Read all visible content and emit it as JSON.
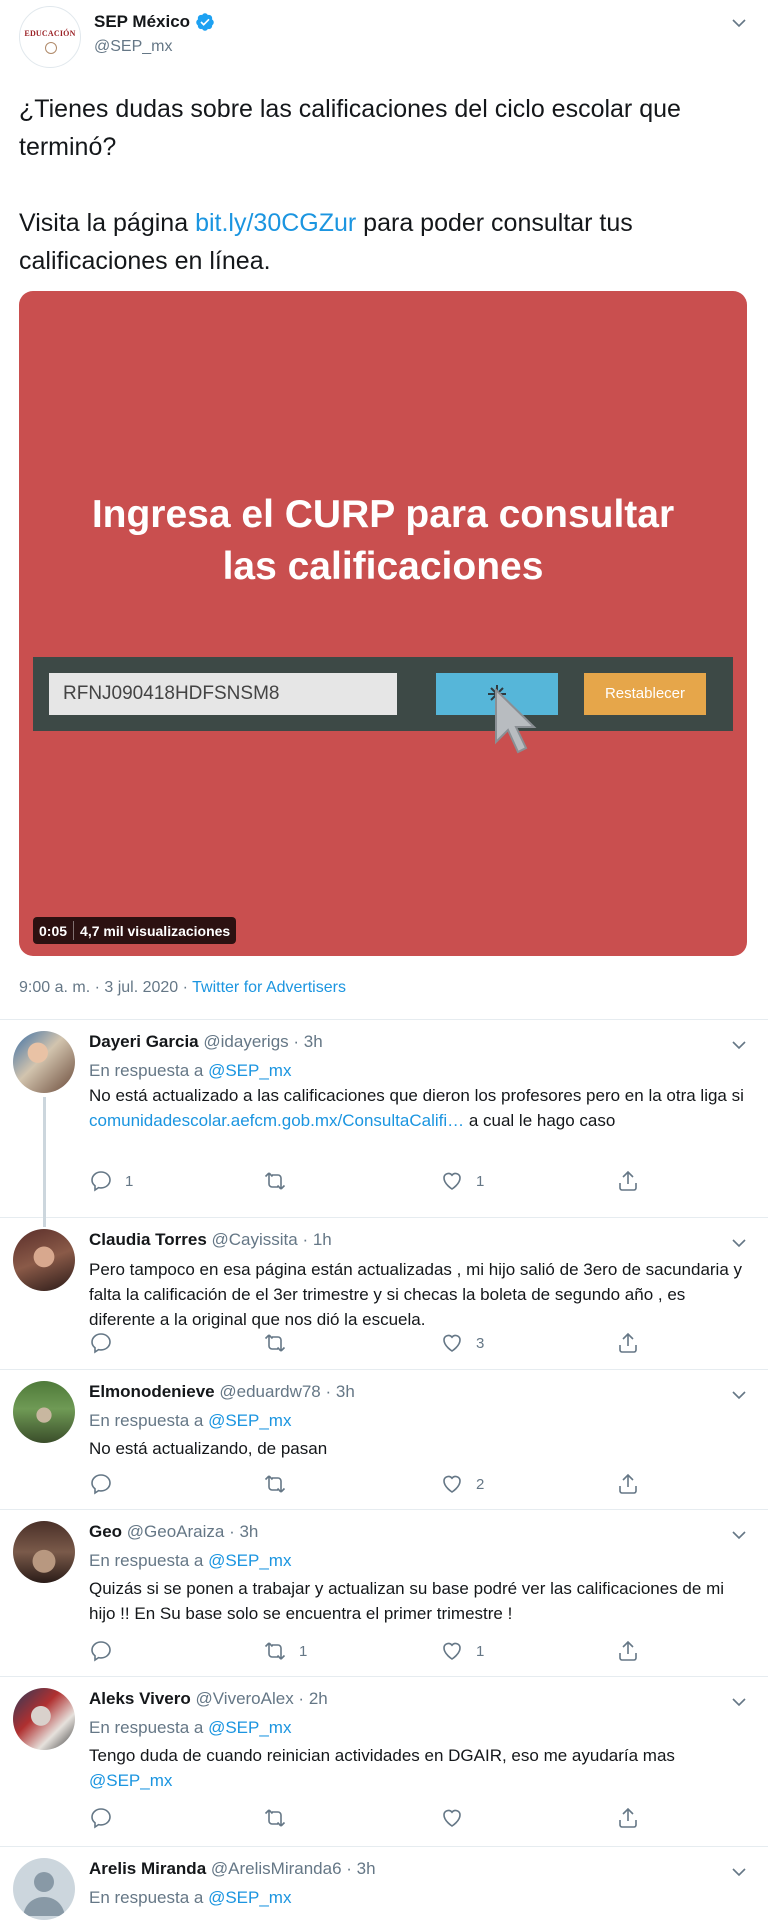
{
  "main_tweet": {
    "avatar_logo_text": "EDUCACIÓN",
    "name": "SEP México",
    "handle": "@SEP_mx",
    "text_line1": "¿Tienes dudas sobre las calificaciones del ciclo escolar que terminó?",
    "text_pre_link": "Visita la página ",
    "link": "bit.ly/30CGZur",
    "text_post_link": " para poder consultar tus calificaciones en línea.",
    "media": {
      "title_line1": "Ingresa el CURP para consultar",
      "title_line2": "las calificaciones",
      "curp_value": "RFNJ090418HDFSNSM8",
      "reset_label": "Restablecer",
      "duration": "0:05",
      "views": "4,7 mil visualizaciones"
    },
    "time": "9:00 a. m. · 3 jul. 2020 · ",
    "source": "Twitter for Advertisers"
  },
  "replies": [
    {
      "name": "Dayeri Garcia",
      "handle": "@idayerigs · 3h",
      "reply_to_label": "En respuesta a ",
      "reply_to": "@SEP_mx",
      "text_pre": "No está actualizado a las calificaciones que dieron los profesores pero en la otra liga si ",
      "text_link": "comunidadescolar.aefcm.gob.mx/ConsultaCalifi…",
      "text_post": " a cual le hago caso",
      "replies": "1",
      "retweets": "",
      "likes": "1"
    },
    {
      "name": "Claudia Torres",
      "handle": "@Cayissita · 1h",
      "text": "Pero tampoco en esa página están actualizadas , mi hijo salió de 3ero de sacundaria y falta la calificación de el 3er trimestre y si checas la boleta de segundo año , es diferente a la original que nos dió la escuela.",
      "replies": "",
      "retweets": "",
      "likes": "3"
    },
    {
      "name": "Elmonodenieve",
      "handle": "@eduardw78 · 3h",
      "reply_to_label": "En respuesta a ",
      "reply_to": "@SEP_mx",
      "text": "No está actualizando, de pasan",
      "replies": "",
      "retweets": "",
      "likes": "2"
    },
    {
      "name": "Geo",
      "handle": "@GeoAraiza · 3h",
      "reply_to_label": "En respuesta a ",
      "reply_to": "@SEP_mx",
      "text": "Quizás si se ponen a trabajar y actualizan su base podré ver las calificaciones de mi hijo !! En Su base solo se encuentra el primer trimestre !",
      "replies": "",
      "retweets": "1",
      "likes": "1"
    },
    {
      "name": "Aleks Vivero",
      "handle": "@ViveroAlex · 2h",
      "reply_to_label": "En respuesta a ",
      "reply_to": "@SEP_mx",
      "text_pre": "Tengo duda de cuando reinician actividades en DGAIR, eso me ayudaría mas ",
      "text_link": "@SEP_mx",
      "replies": "",
      "retweets": "",
      "likes": ""
    },
    {
      "name": "Arelis Miranda",
      "handle": "@ArelisMiranda6 · 3h",
      "reply_to_label": "En respuesta a ",
      "reply_to": "@SEP_mx"
    }
  ],
  "colors": {
    "link": "#1b95e0",
    "media_bg": "#c94f4f",
    "search_button": "#56b6d9",
    "reset_button": "#e6a64a",
    "muted": "#657786"
  }
}
